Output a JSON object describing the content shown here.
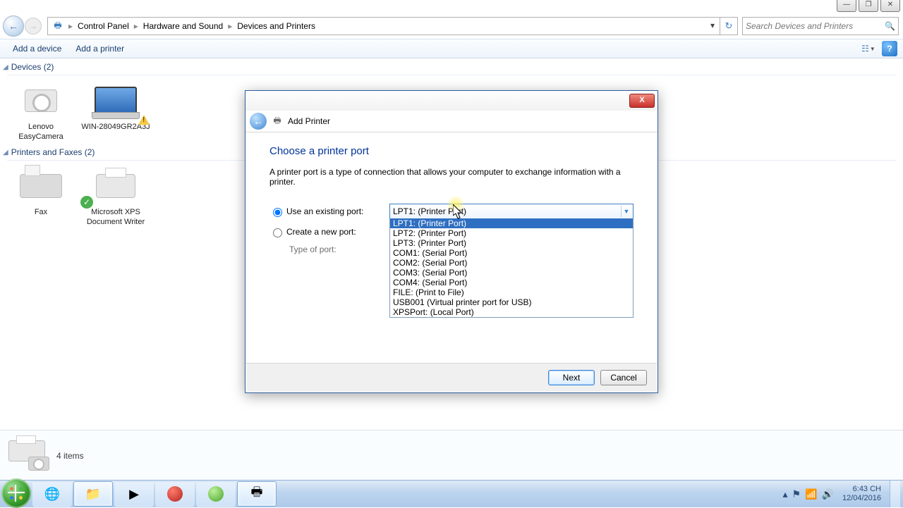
{
  "breadcrumb": {
    "a": "Control Panel",
    "b": "Hardware and Sound",
    "c": "Devices and Printers"
  },
  "search": {
    "placeholder": "Search Devices and Printers"
  },
  "cmdbar": {
    "add_device": "Add a device",
    "add_printer": "Add a printer"
  },
  "sections": {
    "devices": "Devices (2)",
    "printers": "Printers and Faxes (2)"
  },
  "devices": {
    "cam": "Lenovo EasyCamera",
    "pc": "WIN-28049GR2A3J"
  },
  "printers": {
    "fax": "Fax",
    "xps": "Microsoft XPS Document Writer"
  },
  "details": {
    "count": "4 items"
  },
  "dialog": {
    "title": "Add Printer",
    "h1": "Choose a printer port",
    "desc": "A printer port is a type of connection that allows your computer to exchange information with a printer.",
    "opt_existing": "Use an existing port:",
    "opt_create": "Create a new port:",
    "type_label": "Type of port:",
    "selected": "LPT1: (Printer Port)",
    "options": {
      "o0": "LPT1: (Printer Port)",
      "o1": "LPT2: (Printer Port)",
      "o2": "LPT3: (Printer Port)",
      "o3": "COM1: (Serial Port)",
      "o4": "COM2: (Serial Port)",
      "o5": "COM3: (Serial Port)",
      "o6": "COM4: (Serial Port)",
      "o7": "FILE: (Print to File)",
      "o8": "USB001 (Virtual printer port for USB)",
      "o9": "XPSPort: (Local Port)"
    },
    "next": "Next",
    "cancel": "Cancel",
    "close_x": "X"
  },
  "tray": {
    "time": "6:43 CH",
    "date": "12/04/2016"
  }
}
